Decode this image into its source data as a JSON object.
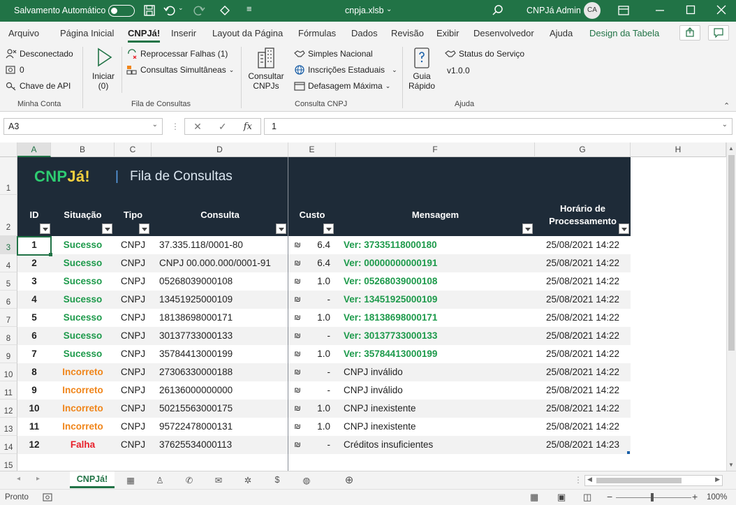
{
  "titlebar": {
    "autosave_label": "Salvamento Automático",
    "filename": "cnpja.xlsb",
    "user": "CNPJá Admin",
    "initials": "CA"
  },
  "menu": {
    "tabs": [
      "Arquivo",
      "Página Inicial",
      "CNPJá!",
      "Inserir",
      "Layout da Página",
      "Fórmulas",
      "Dados",
      "Revisão",
      "Exibir",
      "Desenvolvedor",
      "Ajuda",
      "Design da Tabela"
    ],
    "active": "CNPJá!"
  },
  "ribbon": {
    "minha_conta": {
      "desconectado": "Desconectado",
      "credits": "0",
      "chave": "Chave de API",
      "label": "Minha Conta"
    },
    "fila": {
      "iniciar": "Iniciar",
      "iniciar_count": "(0)",
      "reprocessar": "Reprocessar Falhas (1)",
      "simultaneas": "Consultas Simultâneas",
      "label": "Fila de Consultas"
    },
    "consulta": {
      "consultar": "Consultar",
      "consultar2": "CNPJs",
      "simples": "Simples Nacional",
      "inscricoes": "Inscrições Estaduais",
      "defasagem": "Defasagem Máxima",
      "label": "Consulta CNPJ"
    },
    "ajuda": {
      "guia": "Guia",
      "guia2": "Rápido",
      "status": "Status do Serviço",
      "version": "v1.0.0",
      "label": "Ajuda"
    }
  },
  "formula": {
    "namebox": "A3",
    "value": "1"
  },
  "colors": {
    "excel_green": "#217346",
    "banner": "#1e2b38",
    "success": "#1d9a4b",
    "warning": "#f0851a",
    "fail": "#e8202a",
    "logo_green": "#2ecc71",
    "logo_yellow": "#f4d03f"
  },
  "columns": [
    "A",
    "B",
    "C",
    "D",
    "E",
    "F",
    "G",
    "H"
  ],
  "banner": {
    "logo_a": "CNP",
    "logo_b": "Já!",
    "sep": "|",
    "title": "Fila de Consultas"
  },
  "headers": {
    "id": "ID",
    "situacao": "Situação",
    "tipo": "Tipo",
    "consulta": "Consulta",
    "custo": "Custo",
    "mensagem": "Mensagem",
    "horario1": "Horário de",
    "horario2": "Processamento"
  },
  "rows": [
    {
      "id": "1",
      "situacao": "Sucesso",
      "status": "success",
      "tipo": "CNPJ",
      "consulta": "37.335.118/0001-80",
      "custo": "6.4",
      "mensagem": "Ver: 37335118000180",
      "msg_link": true,
      "horario": "25/08/2021 14:22"
    },
    {
      "id": "2",
      "situacao": "Sucesso",
      "status": "success",
      "tipo": "CNPJ",
      "consulta": "CNPJ 00.000.000/0001-91",
      "custo": "6.4",
      "mensagem": "Ver: 00000000000191",
      "msg_link": true,
      "horario": "25/08/2021 14:22"
    },
    {
      "id": "3",
      "situacao": "Sucesso",
      "status": "success",
      "tipo": "CNPJ",
      "consulta": "05268039000108",
      "custo": "1.0",
      "mensagem": "Ver: 05268039000108",
      "msg_link": true,
      "horario": "25/08/2021 14:22"
    },
    {
      "id": "4",
      "situacao": "Sucesso",
      "status": "success",
      "tipo": "CNPJ",
      "consulta": "13451925000109",
      "custo": "-",
      "mensagem": "Ver: 13451925000109",
      "msg_link": true,
      "horario": "25/08/2021 14:22"
    },
    {
      "id": "5",
      "situacao": "Sucesso",
      "status": "success",
      "tipo": "CNPJ",
      "consulta": "18138698000171",
      "custo": "1.0",
      "mensagem": "Ver: 18138698000171",
      "msg_link": true,
      "horario": "25/08/2021 14:22"
    },
    {
      "id": "6",
      "situacao": "Sucesso",
      "status": "success",
      "tipo": "CNPJ",
      "consulta": "30137733000133",
      "custo": "-",
      "mensagem": "Ver: 30137733000133",
      "msg_link": true,
      "horario": "25/08/2021 14:22"
    },
    {
      "id": "7",
      "situacao": "Sucesso",
      "status": "success",
      "tipo": "CNPJ",
      "consulta": "35784413000199",
      "custo": "1.0",
      "mensagem": "Ver: 35784413000199",
      "msg_link": true,
      "horario": "25/08/2021 14:22"
    },
    {
      "id": "8",
      "situacao": "Incorreto",
      "status": "warning",
      "tipo": "CNPJ",
      "consulta": "27306330000188",
      "custo": "-",
      "mensagem": "CNPJ inválido",
      "msg_link": false,
      "horario": "25/08/2021 14:22"
    },
    {
      "id": "9",
      "situacao": "Incorreto",
      "status": "warning",
      "tipo": "CNPJ",
      "consulta": "26136000000000",
      "custo": "-",
      "mensagem": "CNPJ inválido",
      "msg_link": false,
      "horario": "25/08/2021 14:22"
    },
    {
      "id": "10",
      "situacao": "Incorreto",
      "status": "warning",
      "tipo": "CNPJ",
      "consulta": "50215563000175",
      "custo": "1.0",
      "mensagem": "CNPJ inexistente",
      "msg_link": false,
      "horario": "25/08/2021 14:22"
    },
    {
      "id": "11",
      "situacao": "Incorreto",
      "status": "warning",
      "tipo": "CNPJ",
      "consulta": "95722478000131",
      "custo": "1.0",
      "mensagem": "CNPJ inexistente",
      "msg_link": false,
      "horario": "25/08/2021 14:22"
    },
    {
      "id": "12",
      "situacao": "Falha",
      "status": "fail",
      "tipo": "CNPJ",
      "consulta": "37625534000113",
      "custo": "-",
      "mensagem": "Créditos insuficientes",
      "msg_link": false,
      "horario": "25/08/2021 14:23"
    }
  ],
  "currency_symbol": "₪",
  "sheet": {
    "active": "CNPJá!"
  },
  "status": {
    "mode": "Pronto",
    "zoom": "100%"
  }
}
